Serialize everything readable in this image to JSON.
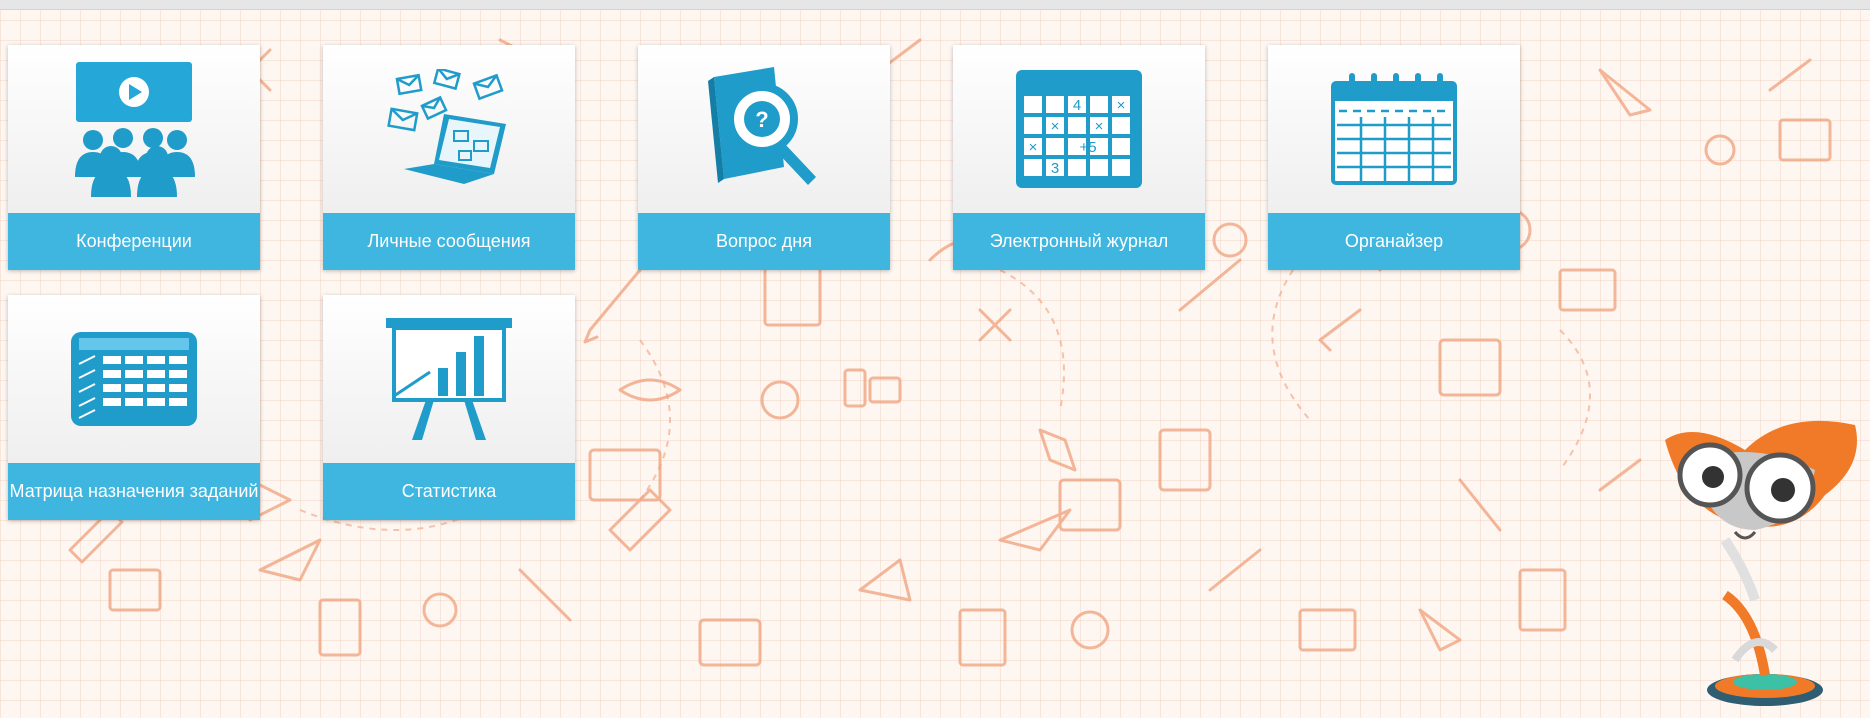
{
  "tiles": [
    {
      "label": "Конференции",
      "icon": "conference-icon"
    },
    {
      "label": "Личные сообщения",
      "icon": "messages-icon"
    },
    {
      "label": "Вопрос дня",
      "icon": "question-book-icon"
    },
    {
      "label": "Электронный журнал",
      "icon": "grade-journal-icon"
    },
    {
      "label": "Органайзер",
      "icon": "calendar-icon"
    },
    {
      "label": "Матрица назначения заданий",
      "icon": "matrix-table-icon"
    },
    {
      "label": "Статистика",
      "icon": "statistics-board-icon"
    }
  ],
  "journal_icon": {
    "n1": "4",
    "n2": "+5",
    "n3": "3",
    "x": "×"
  },
  "colors": {
    "accent": "#3eb6df",
    "icon_blue": "#1f9cc9",
    "doodle": "#f0a07a",
    "background": "#fdf6f1",
    "mascot_orange": "#f07a28"
  }
}
